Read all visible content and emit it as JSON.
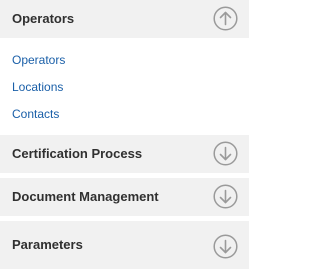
{
  "accordion": {
    "sections": [
      {
        "title": "Operators",
        "state": "expanded",
        "toggle_icon": "chevron-up-circle-icon",
        "links": [
          "Operators",
          "Locations",
          "Contacts"
        ]
      },
      {
        "title": "Certification Process",
        "state": "collapsed",
        "toggle_icon": "chevron-down-circle-icon"
      },
      {
        "title": "Document Management",
        "state": "collapsed",
        "toggle_icon": "chevron-down-circle-icon"
      },
      {
        "title": "Parameters",
        "state": "collapsed",
        "toggle_icon": "chevron-down-circle-icon"
      }
    ]
  },
  "colors": {
    "header_background": "#f1f1f1",
    "header_text": "#303030",
    "link_text": "#1a5fa8",
    "icon_stroke": "#9a9a9a"
  }
}
